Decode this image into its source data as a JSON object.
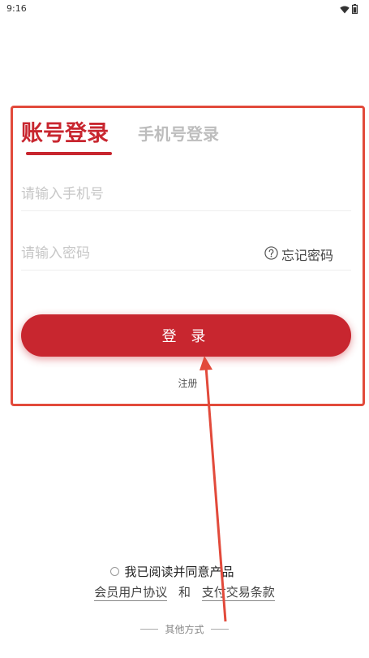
{
  "status_bar": {
    "time": "9:16",
    "icons": [
      "wifi-icon",
      "battery-icon"
    ]
  },
  "login": {
    "tabs": {
      "account": "账号登录",
      "phone": "手机号登录"
    },
    "phone_placeholder": "请输入手机号",
    "password_placeholder": "请输入密码",
    "forgot_password": "忘记密码",
    "login_button": "登 录",
    "register": "注册"
  },
  "agreement": {
    "prefix": "我已阅读并同意产品",
    "user_agreement": "会员用户协议",
    "and": "和",
    "payment_terms": "支付交易条款"
  },
  "other_methods": "其他方式",
  "colors": {
    "brand_red": "#c8262f",
    "annotation_red": "#e24a3b",
    "placeholder": "#c7c7c7"
  }
}
